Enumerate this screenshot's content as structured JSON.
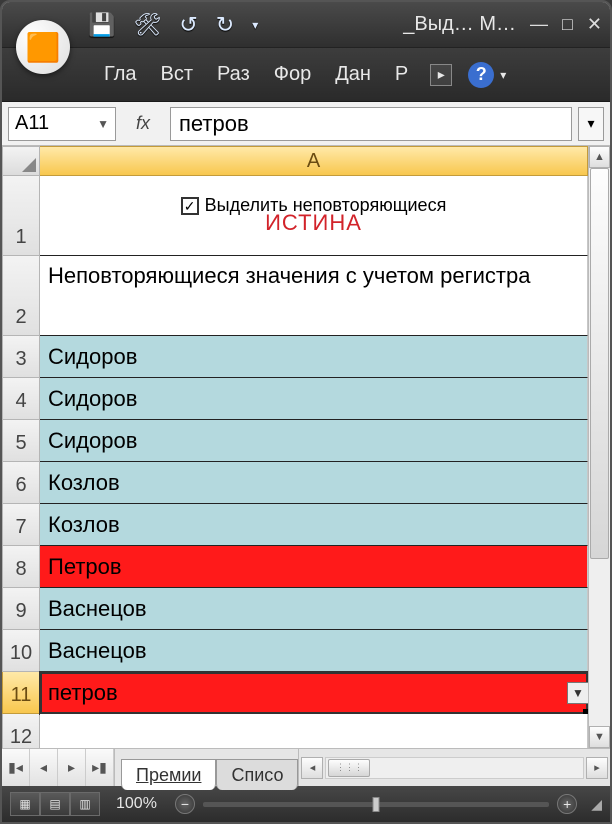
{
  "titlebar": {
    "title": "_Выд… M…",
    "qat": {
      "save": "💾",
      "tool": "🛠",
      "undo": "↺",
      "redo": "↻",
      "more": "▾"
    },
    "window_controls": {
      "min": "—",
      "max": "□",
      "close": "✕"
    }
  },
  "ribbon": {
    "tabs": [
      "Гла",
      "Вст",
      "Раз",
      "Фор",
      "Дан",
      "Р"
    ],
    "expand": "▸",
    "help": "?",
    "dropdown": "▾"
  },
  "formula_bar": {
    "name_box": "A11",
    "fx_label": "fx",
    "formula": "петров",
    "expand": "▾"
  },
  "sheet": {
    "column_header": "A",
    "rows": [
      {
        "num": "1",
        "type": "checkbox",
        "checkbox_label": "Выделить неповторяющиеся",
        "checked": true,
        "truth": "ИСТИНА"
      },
      {
        "num": "2",
        "type": "plain",
        "text": "Неповторяющиеся значения с учетом регистра",
        "multiline": true
      },
      {
        "num": "3",
        "type": "data",
        "text": "Сидоров",
        "fill": "lightblue"
      },
      {
        "num": "4",
        "type": "data",
        "text": "Сидоров",
        "fill": "lightblue"
      },
      {
        "num": "5",
        "type": "data",
        "text": "Сидоров",
        "fill": "lightblue"
      },
      {
        "num": "6",
        "type": "data",
        "text": "Козлов",
        "fill": "lightblue"
      },
      {
        "num": "7",
        "type": "data",
        "text": "Козлов",
        "fill": "lightblue"
      },
      {
        "num": "8",
        "type": "data",
        "text": "Петров",
        "fill": "red"
      },
      {
        "num": "9",
        "type": "data",
        "text": "Васнецов",
        "fill": "lightblue"
      },
      {
        "num": "10",
        "type": "data",
        "text": "Васнецов",
        "fill": "lightblue"
      },
      {
        "num": "11",
        "type": "data",
        "text": "петров",
        "fill": "red",
        "selected": true,
        "dropdown": true
      },
      {
        "num": "12",
        "type": "plain",
        "text": ""
      }
    ]
  },
  "sheet_tabs": {
    "nav": {
      "first": "▮◂",
      "prev": "◂",
      "next": "▸",
      "last": "▸▮"
    },
    "tabs": [
      {
        "label": "Премии",
        "active": true
      },
      {
        "label": "Списо",
        "active": false
      }
    ]
  },
  "hscroll": {
    "left": "◂",
    "right": "▸",
    "thumb": "⋮⋮⋮"
  },
  "statusbar": {
    "views": [
      "▦",
      "▤",
      "▥"
    ],
    "zoom_pct": "100%",
    "zoom_minus": "−",
    "zoom_plus": "+",
    "grip": "◢"
  }
}
